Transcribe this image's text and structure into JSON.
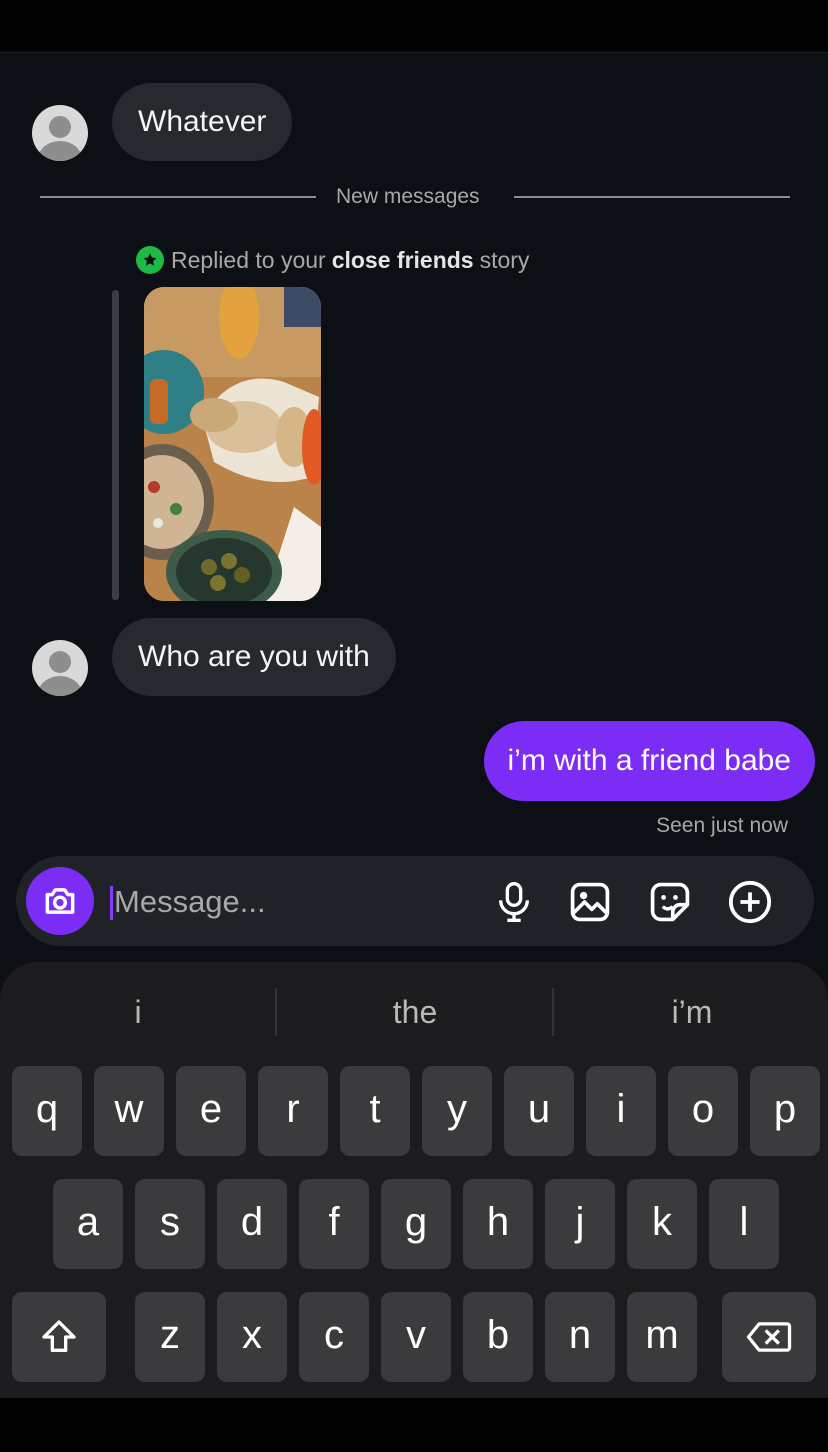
{
  "chat": {
    "messages": [
      {
        "from": "them",
        "text": "Whatever"
      },
      {
        "from": "them",
        "text": "Who are you with"
      },
      {
        "from": "me",
        "text": "i’m with a friend babe"
      }
    ],
    "divider": "New messages",
    "story_reply": {
      "pre": "Replied to your",
      "bold": "close friends",
      "post": "story"
    },
    "seen": "Seen just now"
  },
  "composer": {
    "placeholder": "Message..."
  },
  "keyboard": {
    "suggestions": [
      "i",
      "the",
      "i’m"
    ],
    "row1": [
      "q",
      "w",
      "e",
      "r",
      "t",
      "y",
      "u",
      "i",
      "o",
      "p"
    ],
    "row2": [
      "a",
      "s",
      "d",
      "f",
      "g",
      "h",
      "j",
      "k",
      "l"
    ],
    "row3": [
      "z",
      "x",
      "c",
      "v",
      "b",
      "n",
      "m"
    ]
  },
  "colors": {
    "accent": "#7b2cf5",
    "close_friends": "#1dbb46",
    "background": "#0c1014"
  },
  "icons": [
    "avatar-icon",
    "star-icon",
    "camera-icon",
    "microphone-icon",
    "gallery-icon",
    "sticker-icon",
    "plus-icon",
    "shift-icon",
    "backspace-icon"
  ]
}
